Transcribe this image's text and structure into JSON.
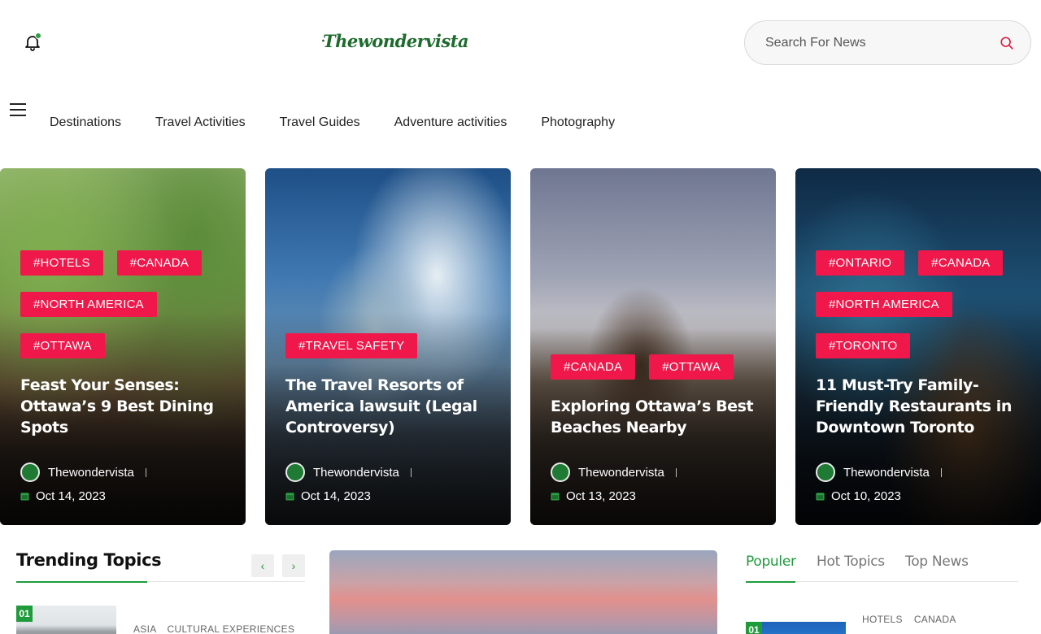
{
  "header": {
    "logo_text": "Thewondervista",
    "search_placeholder": "Search For News"
  },
  "nav": {
    "items": [
      "Destinations",
      "Travel Activities",
      "Travel Guides",
      "Adventure activities",
      "Photography"
    ]
  },
  "cards": [
    {
      "tags": [
        "#HOTELS",
        "#CANADA",
        "#NORTH AMERICA",
        "#OTTAWA"
      ],
      "title": "Feast Your Senses: Ottawa’s 9 Best Dining Spots",
      "author": "Thewondervista",
      "date": "Oct 14, 2023"
    },
    {
      "tags": [
        "#TRAVEL SAFETY"
      ],
      "title": "The Travel Resorts of America lawsuit (Legal Controversy)",
      "author": "Thewondervista",
      "date": "Oct 14, 2023"
    },
    {
      "tags": [
        "#CANADA",
        "#OTTAWA"
      ],
      "title": "Exploring Ottawa’s Best Beaches Nearby",
      "author": "Thewondervista",
      "date": "Oct 13, 2023"
    },
    {
      "tags": [
        "#ONTARIO",
        "#CANADA",
        "#NORTH AMERICA",
        "#TORONTO"
      ],
      "title": "11 Must-Try Family-Friendly Restaurants in Downtown Toronto",
      "author": "Thewondervista",
      "date": "Oct 10, 2023"
    }
  ],
  "trending": {
    "heading": "Trending Topics",
    "prev_label": "‹",
    "next_label": "›",
    "items": [
      {
        "number": "01",
        "categories": [
          "ASIA",
          "CULTURAL EXPERIENCES"
        ]
      }
    ]
  },
  "side_tabs": {
    "tabs": [
      "Populer",
      "Hot Topics",
      "Top News"
    ],
    "items": [
      {
        "number": "01",
        "categories": [
          "HOTELS",
          "CANADA"
        ]
      }
    ]
  },
  "colors": {
    "accent_green": "#1e9b3b",
    "tag_red": "#f0184a"
  }
}
